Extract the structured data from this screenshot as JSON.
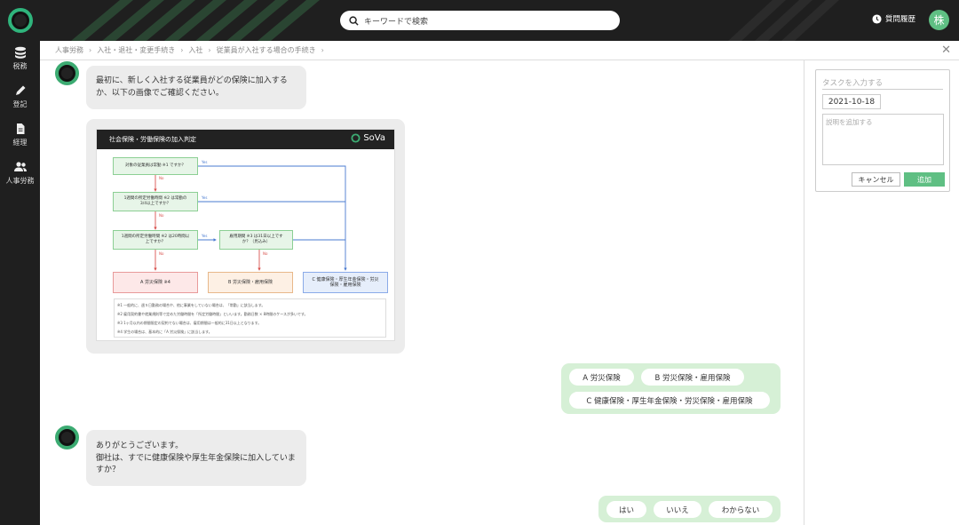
{
  "header": {
    "search_placeholder": "キーワードで検索",
    "history_label": "質問履歴",
    "avatar_text": "株"
  },
  "sidebar": {
    "items": [
      {
        "label": "税務",
        "icon": "database-icon"
      },
      {
        "label": "登記",
        "icon": "pen-icon"
      },
      {
        "label": "経理",
        "icon": "document-icon"
      },
      {
        "label": "人事労務",
        "icon": "users-icon"
      }
    ]
  },
  "breadcrumb": [
    "人事労務",
    "入社・退社・変更手続き",
    "入社",
    "従業員が入社する場合の手続き"
  ],
  "chat": {
    "msg1": "最初に、新しく入社する従業員がどの保険に加入するか、以下の画像でご確認ください。",
    "image": {
      "title": "社会保険・労働保険の加入判定",
      "brand": "SoVa",
      "q1": "対象の従業員は常勤 ※1 ですか？",
      "q2": "1週間の所定労働時間 ※2 は常勤の3/4以上ですか？",
      "q3": "1週間の所定労働時間 ※2 は20時間以上ですか？",
      "q4": "雇用期間 ※3 は31日以上ですか？（見込み）",
      "yes": "Yes",
      "no": "No",
      "resA": "A 労災保険 ※4",
      "resB": "B 労災保険・雇用保険",
      "resC": "C 健康保険・厚生年金保険・労災保険・雇用保険",
      "notes": [
        "※1 一般的に、週５日勤務の場合や、他に事業をしていない場合は、「常勤」に該当します。",
        "※2 雇用契約書や就業規則等で定めた労働時間を「所定労働時間」といいます。勤務日数 × 8時間のケースが多いです。",
        "※3 1ヶ月以内の期間限定の契約でない場合は、雇用期間は一般的に31日以上となります。",
        "※4 学生の場合は、基本的に「A 労災保険」に該当します。"
      ]
    },
    "options1": [
      "A 労災保険",
      "B 労災保険・雇用保険",
      "C 健康保険・厚生年金保険・労災保険・雇用保険"
    ],
    "msg2_line1": "ありがとうございます。",
    "msg2_line2": "御社は、すでに健康保険や厚生年金保険に加入していますか？",
    "options2": [
      "はい",
      "いいえ",
      "わからない"
    ]
  },
  "task": {
    "input_placeholder": "タスクを入力する",
    "date": "2021-10-18",
    "desc_placeholder": "説明を追加する",
    "cancel_label": "キャンセル",
    "add_label": "追加"
  }
}
